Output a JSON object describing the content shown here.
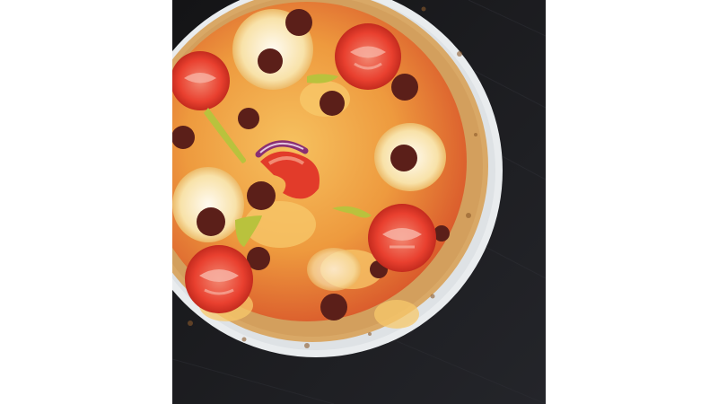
{
  "image": {
    "subject": "pizza-photo",
    "colors": {
      "table": "#1c1c1f",
      "plate": "#e9ecee",
      "crust": "#d9a866",
      "sauce": "#d8542a",
      "cheese": "#f3b85a",
      "egg": "#fbf1cf",
      "pepperoni": "#5b1f19",
      "tomato": "#e9402f",
      "pepper": "#b9c23d",
      "onion": "#8a2f73"
    }
  }
}
